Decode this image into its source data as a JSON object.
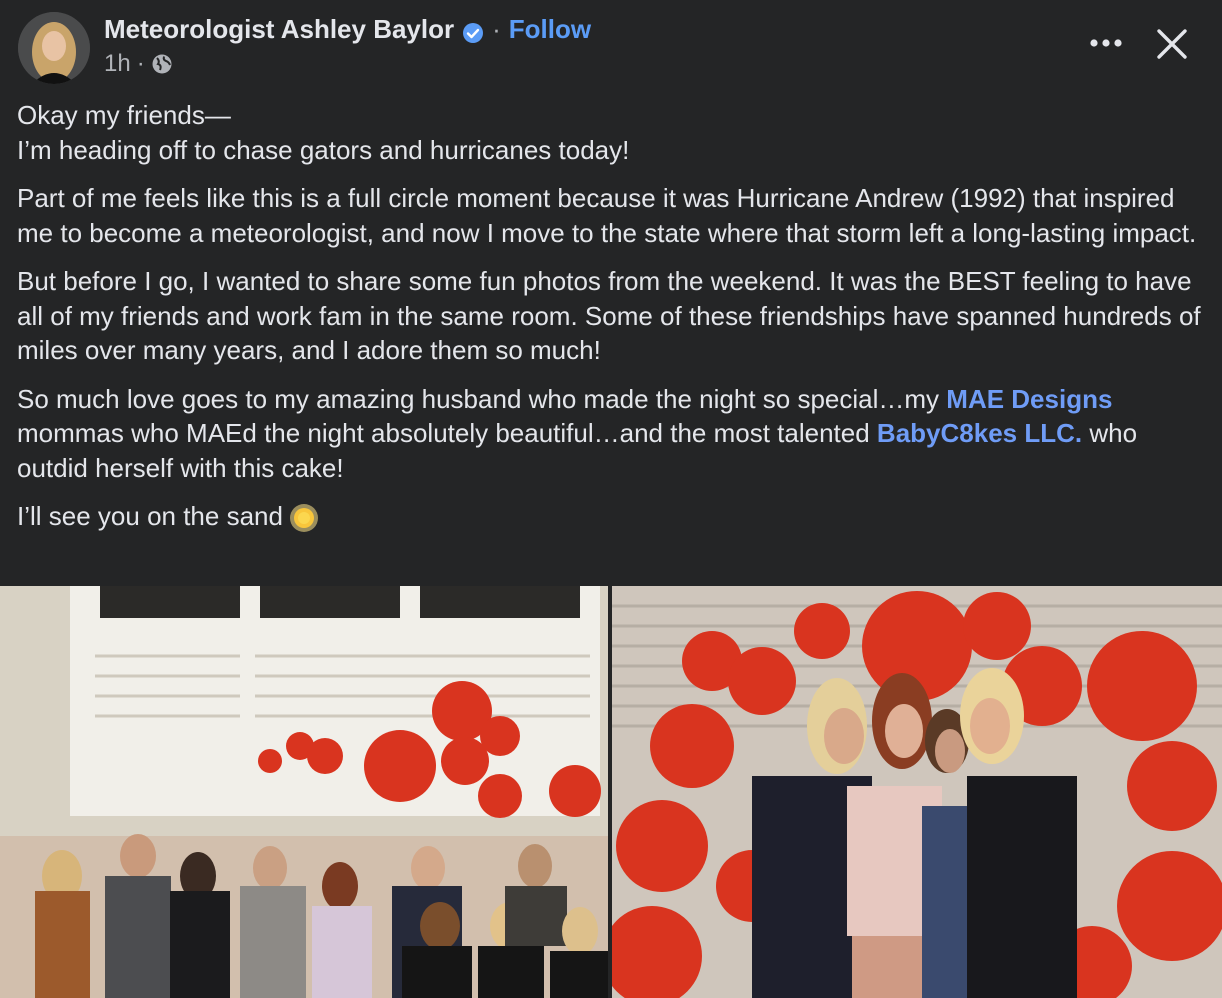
{
  "header": {
    "author_name": "Meteorologist Ashley Baylor",
    "separator": "·",
    "follow_label": "Follow",
    "time": "1h",
    "time_separator": "·"
  },
  "post": {
    "p1_line1": "Okay my friends—",
    "p1_line2": "I’m heading off to chase gators and hurricanes today!",
    "p2": "Part of me feels like this is a full circle moment because it was Hurricane Andrew (1992) that inspired me to become a meteorologist, and now I move to the state where that storm left a long-lasting impact.",
    "p3": "But before I go, I wanted to share some fun photos from the weekend.  It was the BEST feeling to have all of my friends and work fam in the same room.  Some of these friendships have spanned hundreds of miles over many years, and I adore them so much!",
    "p4_a": "So much love goes to my amazing husband who made the night so special…my ",
    "p4_link1": "MAE Designs",
    "p4_b": " mommas who MAEd the night absolutely beautiful…and the most talented ",
    "p4_link2": "BabyC8kes LLC.",
    "p4_c": " who outdid herself with this cake!",
    "p5": "I’ll see you on the sand"
  },
  "icons": {
    "verified": "verified-badge-icon",
    "audience": "globe-icon",
    "more": "more-options-icon",
    "close": "close-icon",
    "emoji": "sun-emoji-icon"
  },
  "colors": {
    "background": "#242526",
    "text": "#e4e6eb",
    "secondary_text": "#b0b3b8",
    "link": "#5b9cf6",
    "balloon": "#d9341f"
  }
}
